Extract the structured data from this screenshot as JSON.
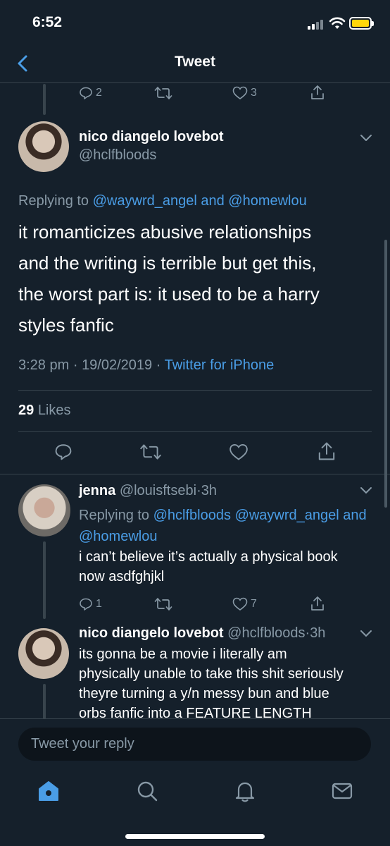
{
  "status_bar": {
    "time": "6:52"
  },
  "nav": {
    "title": "Tweet"
  },
  "prev_tweet_actions": {
    "replies": "2",
    "likes": "3"
  },
  "main_tweet": {
    "author_name": "nico diangelo lovebot",
    "handle": "@hclfbloods",
    "replying_prefix": "Replying to",
    "replying_to_1": "@waywrd_angel",
    "replying_and": "and",
    "replying_to_2": "@homewlou",
    "text_lines": [
      "it romanticizes abusive relationships",
      "and the writing is terrible but get this,",
      "the worst part is: it used to be a harry",
      "styles fanfic"
    ],
    "time": "3:28 pm",
    "sep": "·",
    "date": "19/02/2019",
    "source": "Twitter for iPhone",
    "likes_count": "29",
    "likes_label": "Likes"
  },
  "reply_1": {
    "author_name": "jenna",
    "handle": "@louisftsebi",
    "sep": "·",
    "age": "3h",
    "replying_prefix": "Replying to",
    "replying_to_1": "@hclfbloods",
    "replying_to_2": "@waywrd_angel",
    "replying_and": "and",
    "replying_to_3": "@homewlou",
    "text_lines": [
      "i can’t believe it’s actually a physical book",
      "now asdfghjkl"
    ],
    "replies": "1",
    "likes": "7"
  },
  "reply_2": {
    "author_name": "nico diangelo lovebot",
    "handle": "@hclfbloods",
    "sep": "·",
    "age": "3h",
    "text_lines": [
      "its gonna be a movie i literally am",
      "physically unable to take this shit seriously",
      "theyre turning a y/n messy bun and blue",
      "orbs fanfic into a FEATURE LENGTH"
    ]
  },
  "reply_box": {
    "placeholder": "Tweet your reply"
  },
  "tabs": [
    "home-icon",
    "search-icon",
    "notifications-icon",
    "messages-icon"
  ],
  "colors": {
    "background": "#15202b",
    "accent": "#4a9de6",
    "muted": "#8899a6",
    "divider": "#38444d"
  }
}
